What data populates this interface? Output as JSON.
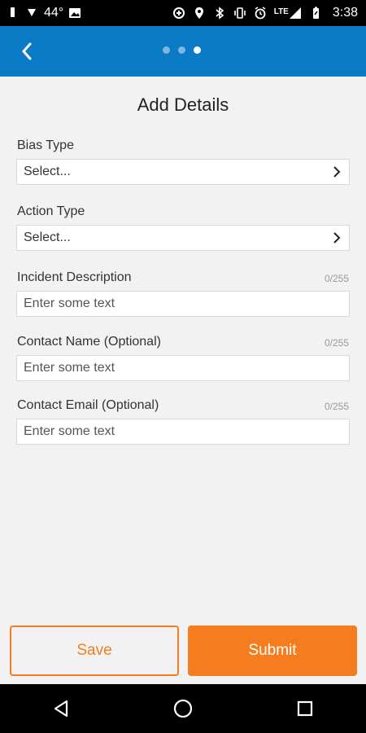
{
  "status_bar": {
    "temperature": "44°",
    "network": "LTE",
    "time": "3:38",
    "icons": [
      "notification-icon",
      "weather-icon",
      "image-icon",
      "data-saver-icon",
      "location-icon",
      "bluetooth-icon",
      "vibrate-icon",
      "alarm-icon",
      "signal-icon",
      "battery-icon"
    ]
  },
  "toolbar": {
    "back_icon": "chevron-left-icon",
    "steps_total": 3,
    "current_step": 3,
    "color": "#0c7bc6"
  },
  "form": {
    "title": "Add Details",
    "bias_type": {
      "label": "Bias Type",
      "value": "Select..."
    },
    "action_type": {
      "label": "Action Type",
      "value": "Select..."
    },
    "incident_description": {
      "label": "Incident Description",
      "counter": "0/255",
      "placeholder": "Enter some text"
    },
    "contact_name": {
      "label": "Contact Name (Optional)",
      "counter": "0/255",
      "placeholder": "Enter some text"
    },
    "contact_email": {
      "label": "Contact Email (Optional)",
      "counter": "0/255",
      "placeholder": "Enter some text"
    }
  },
  "actions": {
    "save_label": "Save",
    "submit_label": "Submit",
    "accent_color": "#f57c1f"
  },
  "nav_bar": {
    "icons": [
      "back-triangle-icon",
      "home-circle-icon",
      "recents-square-icon"
    ]
  }
}
